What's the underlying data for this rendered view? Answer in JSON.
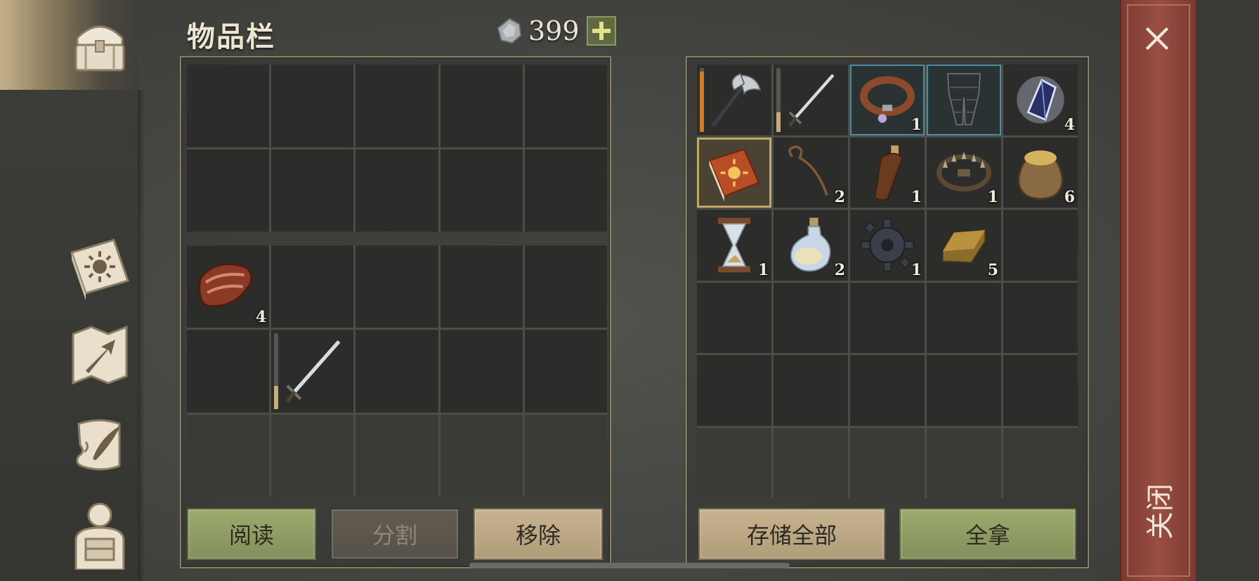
{
  "header": {
    "title": "物品栏",
    "currency_value": "399",
    "currency_icon": "silver-coin-icon",
    "add_icon": "plus-icon"
  },
  "sidebar": {
    "items": [
      {
        "name": "chest-icon",
        "active": true
      },
      {
        "name": "sun-book-icon",
        "active": false
      },
      {
        "name": "map-arrow-icon",
        "active": false
      },
      {
        "name": "scroll-quill-icon",
        "active": false
      },
      {
        "name": "character-backpack-icon",
        "active": false
      }
    ]
  },
  "inventory": {
    "quick_slots": [
      {
        "item": null
      },
      {
        "item": null
      },
      {
        "item": null
      },
      {
        "item": null
      },
      {
        "item": null
      },
      {
        "item": null
      },
      {
        "item": null
      },
      {
        "item": null
      },
      {
        "item": null
      },
      {
        "item": null
      }
    ],
    "bag_slots": [
      {
        "item": "meat-icon",
        "qty": "4"
      },
      {
        "item": null
      },
      {
        "item": null
      },
      {
        "item": null
      },
      {
        "item": null
      },
      {
        "item": null
      },
      {
        "item": "sword-icon",
        "durability": 0.3
      },
      {
        "item": null
      },
      {
        "item": null
      },
      {
        "item": null
      },
      {
        "item": null
      },
      {
        "item": null
      },
      {
        "item": null
      },
      {
        "item": null
      },
      {
        "item": null
      }
    ],
    "buttons": {
      "read": "阅读",
      "split": "分割",
      "remove": "移除"
    }
  },
  "storage": {
    "slots": [
      {
        "item": "battle-axe-icon",
        "durability": 0.95
      },
      {
        "item": "sword-icon",
        "durability": 0.3
      },
      {
        "item": "collar-icon",
        "qty": "1",
        "rarity": "blue"
      },
      {
        "item": "leg-armor-icon",
        "rarity": "blue"
      },
      {
        "item": "crystal-icon",
        "qty": "4"
      },
      {
        "item": "sun-book-icon",
        "selected": true
      },
      {
        "item": "rope-icon",
        "qty": "2"
      },
      {
        "item": "bottle-icon",
        "qty": "1"
      },
      {
        "item": "bear-trap-icon",
        "qty": "1"
      },
      {
        "item": "grain-sack-icon",
        "qty": "6"
      },
      {
        "item": "hourglass-icon",
        "qty": "1"
      },
      {
        "item": "potion-icon",
        "qty": "2"
      },
      {
        "item": "gear-icon",
        "qty": "1"
      },
      {
        "item": "gold-ingot-icon",
        "qty": "5"
      },
      {
        "item": null
      }
    ],
    "buttons": {
      "store_all": "存储全部",
      "take_all": "全拿"
    }
  },
  "close": {
    "label": "关闭",
    "icon": "close-icon"
  },
  "colors": {
    "green_button": "#9bab6e",
    "tan_button": "#c7b391",
    "close_strip": "#9a4e42",
    "rare_border": "#4a8aa3",
    "selected_border": "#c2a867"
  }
}
